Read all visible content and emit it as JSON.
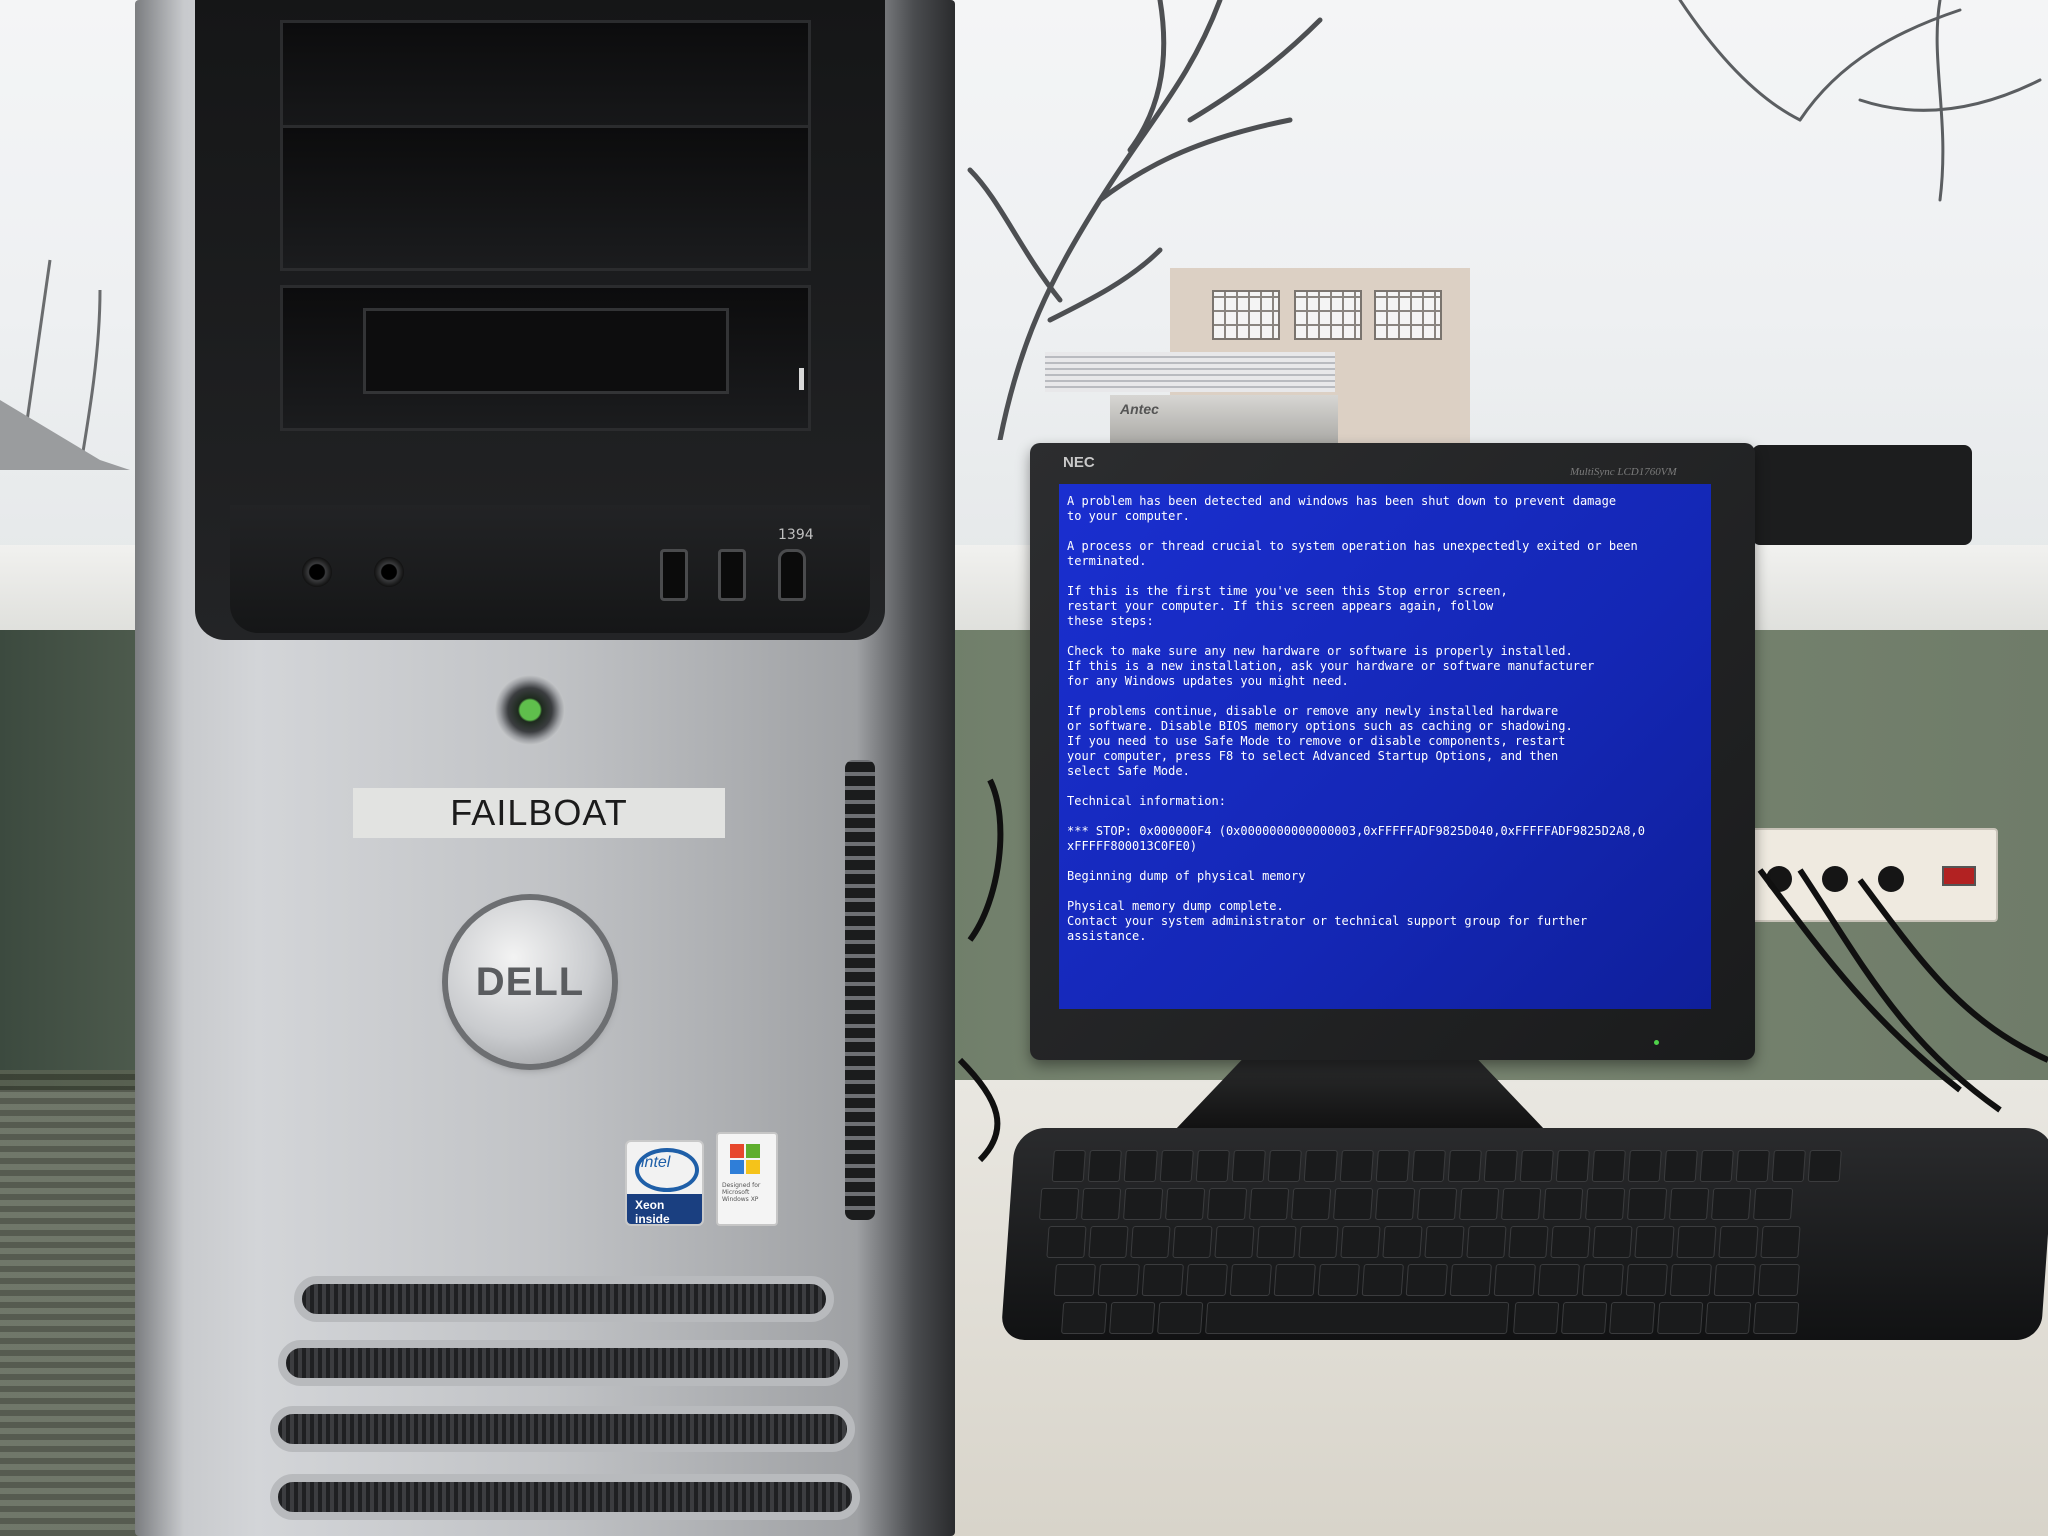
{
  "scene": {
    "tower": {
      "name_label": "FAILBOAT",
      "brand_logo": "DELL",
      "port_labels": {
        "firewire": "1394"
      },
      "stickers": {
        "intel": {
          "logo": "intel",
          "line": "Xeon inside"
        },
        "windows": "Designed for Microsoft Windows XP"
      }
    },
    "monitor": {
      "brand": "NEC",
      "model": "MultiSync LCD1760VM",
      "screen": {
        "background": "#1a2fd0",
        "paragraphs": [
          "A problem has been detected and windows has been shut down to prevent damage\nto your computer.",
          "A process or thread crucial to system operation has unexpectedly exited or been\nterminated.",
          "If this is the first time you've seen this Stop error screen,\nrestart your computer. If this screen appears again, follow\nthese steps:",
          "Check to make sure any new hardware or software is properly installed.\nIf this is a new installation, ask your hardware or software manufacturer\nfor any Windows updates you might need.",
          "If problems continue, disable or remove any newly installed hardware\nor software. Disable BIOS memory options such as caching or shadowing.\nIf you need to use Safe Mode to remove or disable components, restart\nyour computer, press F8 to select Advanced Startup Options, and then\nselect Safe Mode.",
          "Technical information:",
          "*** STOP: 0x000000F4 (0x0000000000000003,0xFFFFFADF9825D040,0xFFFFFADF9825D2A8,0\nxFFFFF800013C0FE0)",
          "",
          "Beginning dump of physical memory",
          "Physical memory dump complete.\nContact your system administrator or technical support group for further\nassistance."
        ]
      }
    },
    "props": {
      "antec_label": "Antec"
    }
  }
}
